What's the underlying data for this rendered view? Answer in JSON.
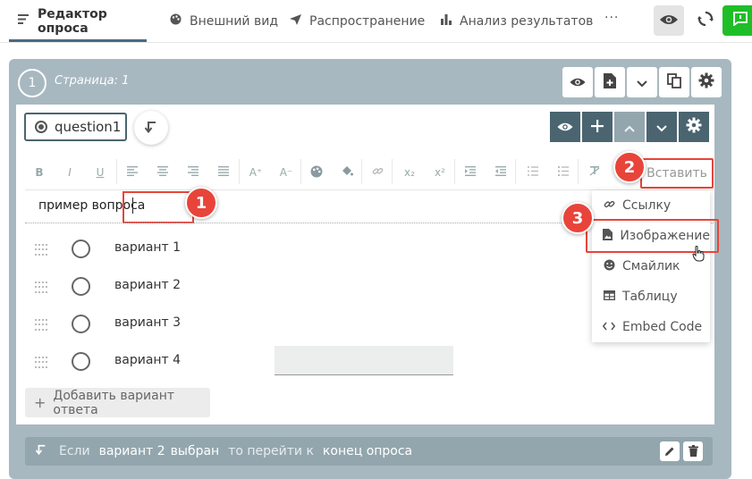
{
  "topbar": {
    "tabs": [
      {
        "label": "Редактор опроса",
        "icon": "edit-lines-icon",
        "active": true
      },
      {
        "label": "Внешний вид",
        "icon": "palette-icon",
        "active": false
      },
      {
        "label": "Распространение",
        "icon": "send-icon",
        "active": false
      },
      {
        "label": "Анализ результатов",
        "icon": "bar-chart-icon",
        "active": false
      }
    ],
    "more_label": "···"
  },
  "page": {
    "number": "1",
    "title": "Страница: 1"
  },
  "question": {
    "name": "question1",
    "text": "пример вопроса",
    "choices": [
      "вариант 1",
      "вариант 2",
      "вариант 3",
      "вариант 4"
    ],
    "add_choice_label": "Добавить вариант ответа"
  },
  "toolbar": {
    "bold": "B",
    "italic": "I",
    "underline": "U",
    "superscript_a": "A⁺",
    "subscript_a": "A⁻",
    "subscript_x": "x₂",
    "superscript_x": "x²",
    "insert_label": "Вставить"
  },
  "insert_menu": {
    "items": [
      {
        "label": "Ссылку",
        "icon": "link-icon"
      },
      {
        "label": "Изображение",
        "icon": "image-icon"
      },
      {
        "label": "Смайлик",
        "icon": "smiley-icon"
      },
      {
        "label": "Таблицу",
        "icon": "table-icon"
      },
      {
        "label": "Embed Code",
        "icon": "code-icon"
      }
    ]
  },
  "badges": [
    "1",
    "2",
    "3"
  ],
  "logic": {
    "if_label": "Если",
    "choice": "вариант 2",
    "state": "выбран",
    "then_label": "то перейти к",
    "target": "конец опроса"
  },
  "colors": {
    "accent_dark": "#4a6570",
    "accent_light": "#93a6ae",
    "page_bg": "#a8b8c0",
    "highlight_red": "#e8443a",
    "green": "#1fbe28"
  }
}
